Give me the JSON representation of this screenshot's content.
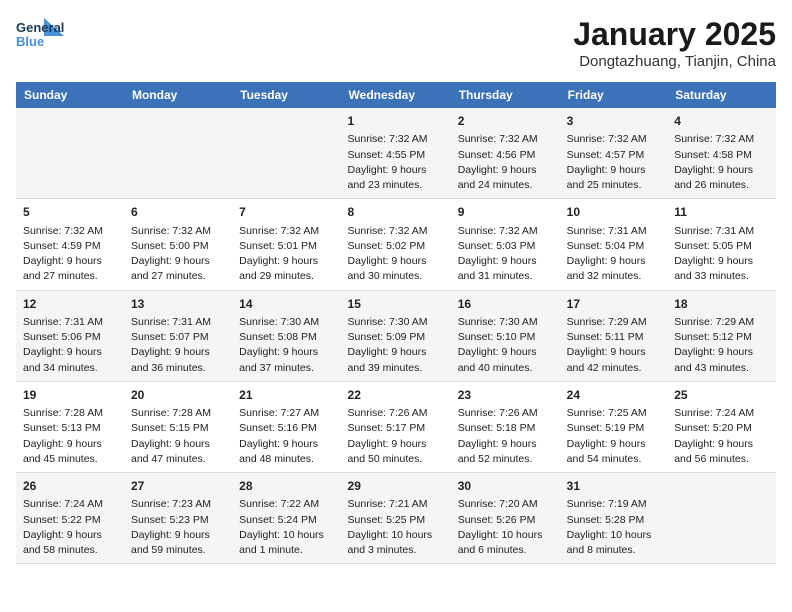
{
  "header": {
    "logo_general": "General",
    "logo_blue": "Blue",
    "month_year": "January 2025",
    "location": "Dongtazhuang, Tianjin, China"
  },
  "days_of_week": [
    "Sunday",
    "Monday",
    "Tuesday",
    "Wednesday",
    "Thursday",
    "Friday",
    "Saturday"
  ],
  "weeks": [
    [
      {
        "day": "",
        "content": ""
      },
      {
        "day": "",
        "content": ""
      },
      {
        "day": "",
        "content": ""
      },
      {
        "day": "1",
        "content": "Sunrise: 7:32 AM\nSunset: 4:55 PM\nDaylight: 9 hours\nand 23 minutes."
      },
      {
        "day": "2",
        "content": "Sunrise: 7:32 AM\nSunset: 4:56 PM\nDaylight: 9 hours\nand 24 minutes."
      },
      {
        "day": "3",
        "content": "Sunrise: 7:32 AM\nSunset: 4:57 PM\nDaylight: 9 hours\nand 25 minutes."
      },
      {
        "day": "4",
        "content": "Sunrise: 7:32 AM\nSunset: 4:58 PM\nDaylight: 9 hours\nand 26 minutes."
      }
    ],
    [
      {
        "day": "5",
        "content": "Sunrise: 7:32 AM\nSunset: 4:59 PM\nDaylight: 9 hours\nand 27 minutes."
      },
      {
        "day": "6",
        "content": "Sunrise: 7:32 AM\nSunset: 5:00 PM\nDaylight: 9 hours\nand 27 minutes."
      },
      {
        "day": "7",
        "content": "Sunrise: 7:32 AM\nSunset: 5:01 PM\nDaylight: 9 hours\nand 29 minutes."
      },
      {
        "day": "8",
        "content": "Sunrise: 7:32 AM\nSunset: 5:02 PM\nDaylight: 9 hours\nand 30 minutes."
      },
      {
        "day": "9",
        "content": "Sunrise: 7:32 AM\nSunset: 5:03 PM\nDaylight: 9 hours\nand 31 minutes."
      },
      {
        "day": "10",
        "content": "Sunrise: 7:31 AM\nSunset: 5:04 PM\nDaylight: 9 hours\nand 32 minutes."
      },
      {
        "day": "11",
        "content": "Sunrise: 7:31 AM\nSunset: 5:05 PM\nDaylight: 9 hours\nand 33 minutes."
      }
    ],
    [
      {
        "day": "12",
        "content": "Sunrise: 7:31 AM\nSunset: 5:06 PM\nDaylight: 9 hours\nand 34 minutes."
      },
      {
        "day": "13",
        "content": "Sunrise: 7:31 AM\nSunset: 5:07 PM\nDaylight: 9 hours\nand 36 minutes."
      },
      {
        "day": "14",
        "content": "Sunrise: 7:30 AM\nSunset: 5:08 PM\nDaylight: 9 hours\nand 37 minutes."
      },
      {
        "day": "15",
        "content": "Sunrise: 7:30 AM\nSunset: 5:09 PM\nDaylight: 9 hours\nand 39 minutes."
      },
      {
        "day": "16",
        "content": "Sunrise: 7:30 AM\nSunset: 5:10 PM\nDaylight: 9 hours\nand 40 minutes."
      },
      {
        "day": "17",
        "content": "Sunrise: 7:29 AM\nSunset: 5:11 PM\nDaylight: 9 hours\nand 42 minutes."
      },
      {
        "day": "18",
        "content": "Sunrise: 7:29 AM\nSunset: 5:12 PM\nDaylight: 9 hours\nand 43 minutes."
      }
    ],
    [
      {
        "day": "19",
        "content": "Sunrise: 7:28 AM\nSunset: 5:13 PM\nDaylight: 9 hours\nand 45 minutes."
      },
      {
        "day": "20",
        "content": "Sunrise: 7:28 AM\nSunset: 5:15 PM\nDaylight: 9 hours\nand 47 minutes."
      },
      {
        "day": "21",
        "content": "Sunrise: 7:27 AM\nSunset: 5:16 PM\nDaylight: 9 hours\nand 48 minutes."
      },
      {
        "day": "22",
        "content": "Sunrise: 7:26 AM\nSunset: 5:17 PM\nDaylight: 9 hours\nand 50 minutes."
      },
      {
        "day": "23",
        "content": "Sunrise: 7:26 AM\nSunset: 5:18 PM\nDaylight: 9 hours\nand 52 minutes."
      },
      {
        "day": "24",
        "content": "Sunrise: 7:25 AM\nSunset: 5:19 PM\nDaylight: 9 hours\nand 54 minutes."
      },
      {
        "day": "25",
        "content": "Sunrise: 7:24 AM\nSunset: 5:20 PM\nDaylight: 9 hours\nand 56 minutes."
      }
    ],
    [
      {
        "day": "26",
        "content": "Sunrise: 7:24 AM\nSunset: 5:22 PM\nDaylight: 9 hours\nand 58 minutes."
      },
      {
        "day": "27",
        "content": "Sunrise: 7:23 AM\nSunset: 5:23 PM\nDaylight: 9 hours\nand 59 minutes."
      },
      {
        "day": "28",
        "content": "Sunrise: 7:22 AM\nSunset: 5:24 PM\nDaylight: 10 hours\nand 1 minute."
      },
      {
        "day": "29",
        "content": "Sunrise: 7:21 AM\nSunset: 5:25 PM\nDaylight: 10 hours\nand 3 minutes."
      },
      {
        "day": "30",
        "content": "Sunrise: 7:20 AM\nSunset: 5:26 PM\nDaylight: 10 hours\nand 6 minutes."
      },
      {
        "day": "31",
        "content": "Sunrise: 7:19 AM\nSunset: 5:28 PM\nDaylight: 10 hours\nand 8 minutes."
      },
      {
        "day": "",
        "content": ""
      }
    ]
  ]
}
